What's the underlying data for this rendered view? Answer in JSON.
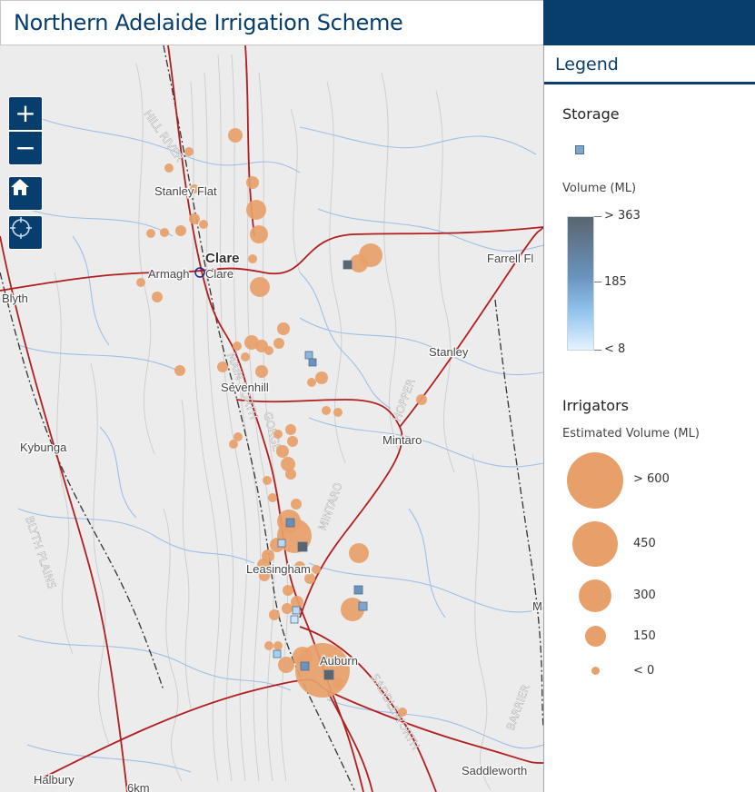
{
  "header": {
    "title": "Northern Adelaide Irrigation Scheme",
    "accent_color": "#073e6e"
  },
  "map_controls": {
    "zoom_in": "+",
    "zoom_out": "−",
    "home_icon": "home-icon",
    "locate_icon": "locate-icon"
  },
  "map_labels": {
    "stanley_flat": "Stanley Flat",
    "clare": "Clare",
    "armagh": "Armagh",
    "clare_small": "Clare",
    "blyth": "Blyth",
    "farrell_flat": "Farrell Fl",
    "stanley": "Stanley",
    "sevenhill": "Sevenhill",
    "kybunga": "Kybunga",
    "mintaro": "Mintaro",
    "leasingham": "Leasingham",
    "auburn": "Auburn",
    "halbury": "Halbury",
    "saddleworth": "Saddleworth",
    "scale": "6km",
    "m_edge": "M",
    "road_hill": "HILL RIVER",
    "road_main": "MAIN NORTH",
    "road_gorge": "GORGE",
    "road_mintaro": "MINTARO",
    "road_hopper": "HOPPER",
    "road_saddleworth": "SADDLEWORTH",
    "road_barrier": "BARRIER",
    "road_blyth": "BLYTH PLAINS"
  },
  "legend": {
    "title": "Legend",
    "storage": {
      "title": "Storage",
      "volume_title": "Volume (ML)",
      "max": "> 363",
      "mid": "185",
      "min": "< 8"
    },
    "irrigators": {
      "title": "Irrigators",
      "volume_title": "Estimated Volume (ML)",
      "classes": [
        "> 600",
        "450",
        "300",
        "150",
        "< 0"
      ]
    }
  },
  "colors": {
    "irrigator": "#e8a06a",
    "storage_dark": "#5a6570",
    "storage_light": "#8fc2ec",
    "road": "#b01e1e",
    "rail": "#333333",
    "water": "#9dc0e6"
  }
}
